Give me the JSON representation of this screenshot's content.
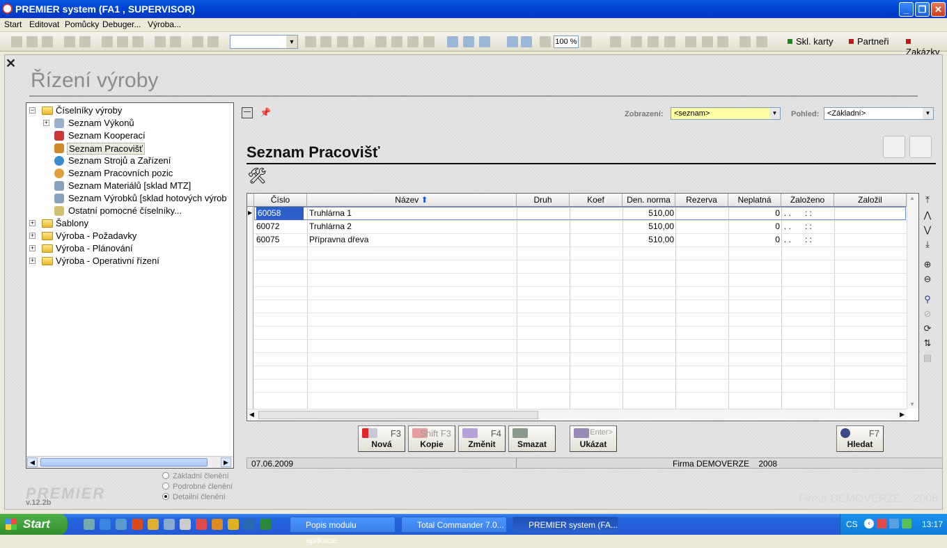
{
  "window": {
    "title": "PREMIER system (FA1 , SUPERVISOR)"
  },
  "menu": [
    "Start",
    "Editovat",
    "Pomůcky",
    "Debuger...",
    "Výroba..."
  ],
  "toolbar": {
    "zoom": "100 %",
    "combo_value": ""
  },
  "quick_links": [
    {
      "label": "Skl. karty",
      "color": "#1a8a1a"
    },
    {
      "label": "Partneři",
      "color": "#c01818"
    },
    {
      "label": "Zakázky",
      "color": "#c01818"
    }
  ],
  "page_title": "Řízení výroby",
  "tree": {
    "root": "Číselníky výroby",
    "children": [
      "Seznam Výkonů",
      "Seznam Kooperací",
      "Seznam Pracovišť",
      "Seznam Strojů a Zařízení",
      "Seznam Pracovních pozic",
      "Seznam Materiálů [sklad MTZ]",
      "Seznam Výrobků [sklad hotových výrob",
      "Ostatní pomocné číselníky..."
    ],
    "others": [
      "Šablony",
      "Výroba - Požadavky",
      "Výroba - Plánování",
      "Výroba - Operativní řízení"
    ]
  },
  "logo": {
    "version": "v.12.2b"
  },
  "radios": [
    {
      "label": "Základní členění",
      "checked": false
    },
    {
      "label": "Podrobné členění",
      "checked": false
    },
    {
      "label": "Detailní členění",
      "checked": true
    }
  ],
  "filters": {
    "zobrazeni_label": "Zobrazení:",
    "zobrazeni_value": "<seznam>",
    "pohled_label": "Pohled:",
    "pohled_value": "<Základní>"
  },
  "section_title": "Seznam Pracovišť",
  "grid": {
    "columns": [
      "Číslo",
      "Název",
      "Druh",
      "Koef",
      "Den. norma",
      "Rezerva",
      "Neplatná",
      "Založeno",
      "Založil"
    ],
    "rows": [
      {
        "cislo": "60058",
        "nazev": "Truhlárna 1",
        "druh": "",
        "koef": "",
        "norma": "510,00",
        "rezerva": "",
        "neplatna": "0",
        "zalozeno": ". .      : :",
        "zalozil": ""
      },
      {
        "cislo": "60072",
        "nazev": "Truhlárna 2",
        "druh": "",
        "koef": "",
        "norma": "510,00",
        "rezerva": "",
        "neplatna": "0",
        "zalozeno": ". .      : :",
        "zalozil": ""
      },
      {
        "cislo": "60075",
        "nazev": "Přípravna dřeva",
        "druh": "",
        "koef": "",
        "norma": "510,00",
        "rezerva": "",
        "neplatna": "0",
        "zalozeno": ". .      : :",
        "zalozil": ""
      }
    ]
  },
  "buttons": {
    "nova": {
      "key": "F3",
      "label": "Nová"
    },
    "kopie": {
      "key": "Shift F3",
      "label": "Kopie"
    },
    "zmenit": {
      "key": "F4",
      "label": "Změnit"
    },
    "smazat": {
      "label": "Smazat"
    },
    "ukazat": {
      "key": "<Enter>",
      "label": "Ukázat"
    },
    "hledat": {
      "key": "F7",
      "label": "Hledat"
    }
  },
  "status": {
    "date": "07.06.2009",
    "firm": "Firma DEMOVERZE    2008"
  },
  "watermark": "Firma DEMOVERZE    2008",
  "taskbar": {
    "start": "Start",
    "tasks": [
      "Popis modulu aplikace...",
      "Total Commander 7.0...",
      "PREMIER system (FA..."
    ],
    "lang": "CS",
    "clock": "13:17"
  }
}
